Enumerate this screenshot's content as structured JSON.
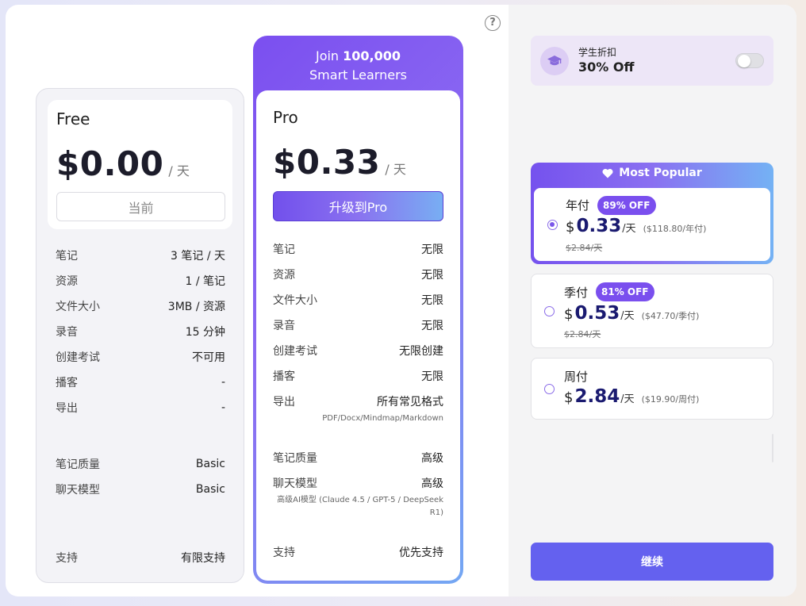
{
  "help_icon": "?",
  "free": {
    "name": "Free",
    "price": "$0.00",
    "unit": "/ 天",
    "button": "当前",
    "features": [
      {
        "k": "笔记",
        "v": "3 笔记 / 天"
      },
      {
        "k": "资源",
        "v": "1 / 笔记"
      },
      {
        "k": "文件大小",
        "v": "3MB / 资源"
      },
      {
        "k": "录音",
        "v": "15 分钟"
      },
      {
        "k": "创建考试",
        "v": "不可用"
      },
      {
        "k": "播客",
        "v": "-"
      },
      {
        "k": "导出",
        "v": "-"
      }
    ],
    "quality": [
      {
        "k": "笔记质量",
        "v": "Basic"
      },
      {
        "k": "聊天模型",
        "v": "Basic"
      }
    ],
    "support": {
      "k": "支持",
      "v": "有限支持"
    }
  },
  "pro": {
    "header_line1_prefix": "Join ",
    "header_line1_num": "100,000",
    "header_line2": "Smart Learners",
    "name": "Pro",
    "price": "$0.33",
    "unit": "/ 天",
    "button": "升级到Pro",
    "features": [
      {
        "k": "笔记",
        "v": "无限"
      },
      {
        "k": "资源",
        "v": "无限"
      },
      {
        "k": "文件大小",
        "v": "无限"
      },
      {
        "k": "录音",
        "v": "无限"
      },
      {
        "k": "创建考试",
        "v": "无限创建"
      },
      {
        "k": "播客",
        "v": "无限"
      },
      {
        "k": "导出",
        "v": "所有常见格式"
      }
    ],
    "export_note": "PDF/Docx/Mindmap/Markdown",
    "quality": [
      {
        "k": "笔记质量",
        "v": "高级"
      },
      {
        "k": "聊天模型",
        "v": "高级"
      }
    ],
    "model_note_1": "高级AI模型 (Claude 4.5 / GPT-5 / DeepSeek",
    "model_note_2": "R1)",
    "support": {
      "k": "支持",
      "v": "优先支持"
    }
  },
  "student": {
    "title": "学生折扣",
    "discount": "30% Off",
    "toggle_on": false,
    "icon": "graduation-cap-icon"
  },
  "popular_label": "Most Popular",
  "options": [
    {
      "name": "年付",
      "badge": "89% OFF",
      "currency": "$",
      "amount": "0.33",
      "per": "/天",
      "total": "($118.80/年付)",
      "strike": "$2.84/天",
      "selected": true
    },
    {
      "name": "季付",
      "badge": "81% OFF",
      "currency": "$",
      "amount": "0.53",
      "per": "/天",
      "total": "($47.70/季付)",
      "strike": "$2.84/天",
      "selected": false
    },
    {
      "name": "周付",
      "currency": "$",
      "amount": "2.84",
      "per": "/天",
      "total": "($19.90/周付)",
      "selected": false
    }
  ],
  "continue_button": "继续",
  "colors": {
    "accent": "#7a4fee",
    "continue": "#6461ef",
    "price_blue": "#1a1a70"
  }
}
